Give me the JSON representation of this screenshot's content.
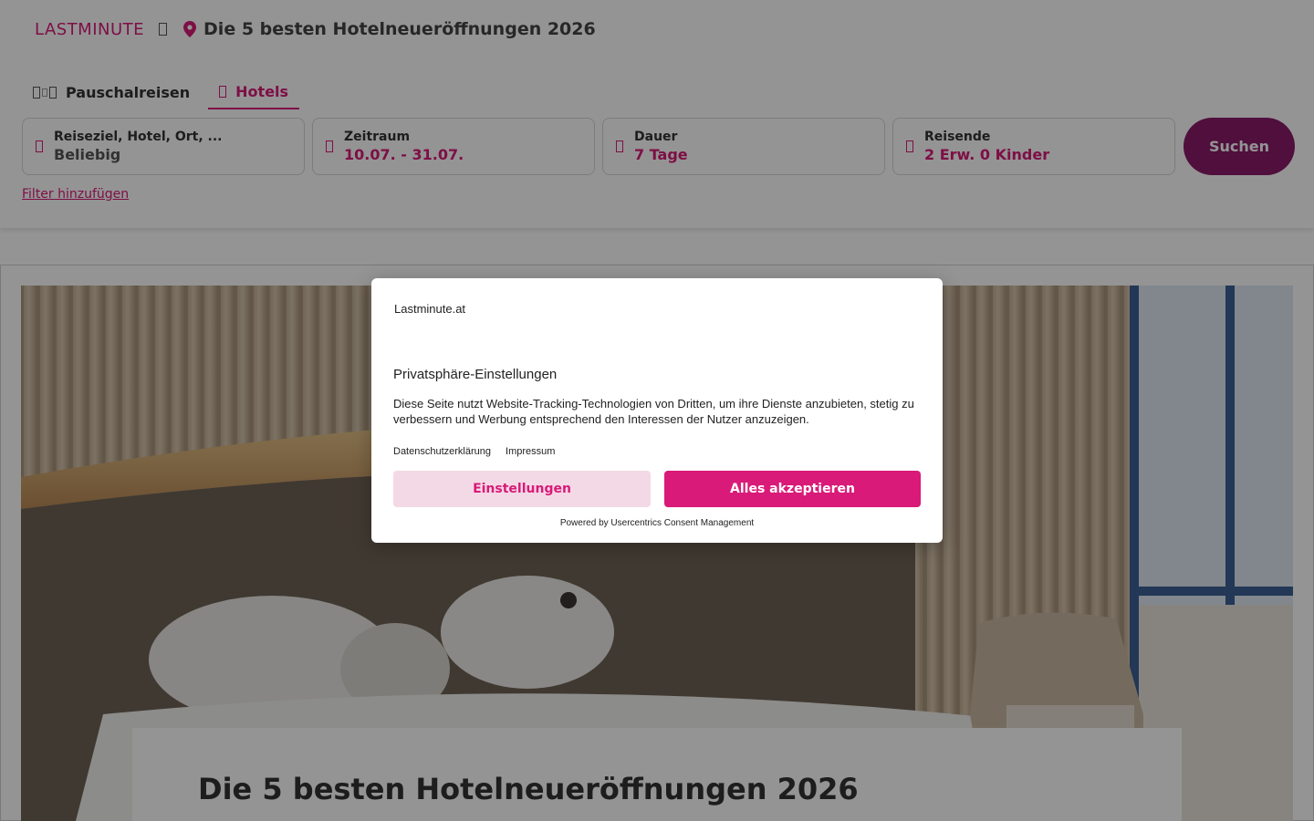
{
  "header": {
    "logo": "LASTMINUTE",
    "breadcrumb_title": "Die 5 besten Hotelneueröffnungen 2026"
  },
  "tabs": [
    {
      "label": "Pauschalreisen",
      "active": false
    },
    {
      "label": "Hotels",
      "active": true
    }
  ],
  "search": {
    "destination": {
      "label": "Reiseziel, Hotel, Ort, ...",
      "value": "Beliebig"
    },
    "period": {
      "label": "Zeitraum",
      "value": "10.07. - 31.07."
    },
    "duration": {
      "label": "Dauer",
      "value": "7 Tage"
    },
    "travelers": {
      "label": "Reisende",
      "value": "2 Erw. 0 Kinder"
    },
    "button": "Suchen",
    "filter_link": "Filter hinzufügen"
  },
  "article": {
    "title": "Die 5 besten Hotelneueröffnungen 2026"
  },
  "consent": {
    "logo_alt": "Lastminute.at",
    "title": "Privatsphäre-Einstellungen",
    "text": "Diese Seite nutzt Website-Tracking-Technologien von Dritten, um ihre Dienste anzubieten, stetig zu verbessern und Werbung entsprechend den Interessen der Nutzer anzuzeigen.",
    "links": [
      "Datenschutzerklärung",
      "Impressum"
    ],
    "settings_button": "Einstellungen",
    "accept_button": "Alles akzeptieren",
    "powered_by": "Powered by Usercentrics Consent Management"
  },
  "colors": {
    "brand": "#d91a78",
    "search_button": "#8a1b6a"
  }
}
